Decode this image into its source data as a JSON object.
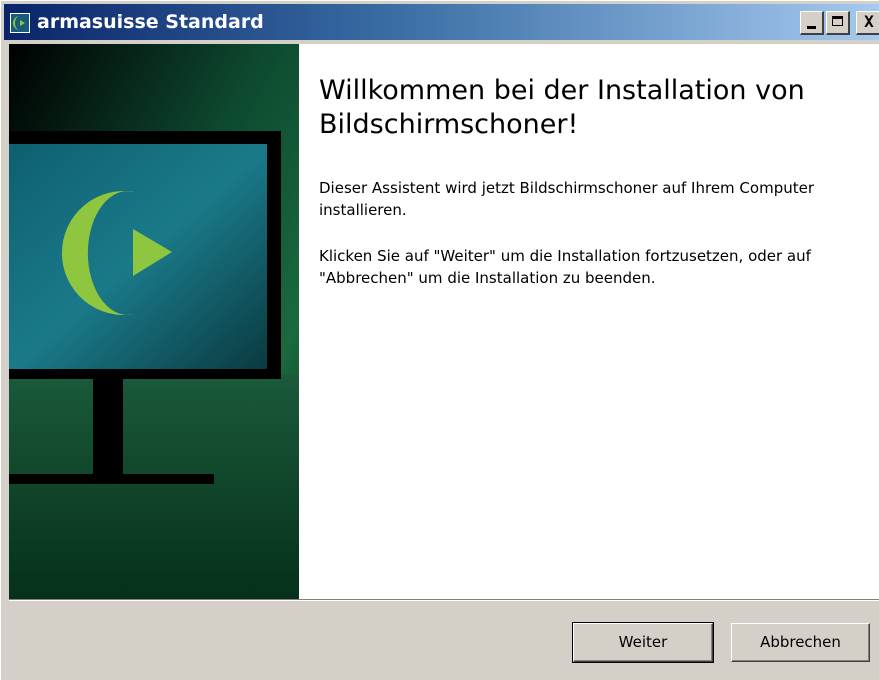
{
  "window": {
    "title": "armasuisse Standard",
    "controls": {
      "minimize_icon": "minimize-icon",
      "maximize_icon": "maximize-icon",
      "close_icon": "close-icon",
      "close_glyph": "X"
    }
  },
  "banner": {
    "logo_icon": "armasuisse-logo-icon",
    "colors": {
      "logo_green": "#8ec63f",
      "screen_teal": "#1a7a8a",
      "frame": "#000000",
      "background_green": "#1a6a3e"
    }
  },
  "content": {
    "heading": "Willkommen bei der Installation von Bildschirmschoner!",
    "paragraph_1": "Dieser Assistent wird jetzt Bildschirmschoner auf Ihrem Computer installieren.",
    "paragraph_2": "Klicken Sie auf \"Weiter\" um die Installation fortzusetzen, oder auf \"Abbrechen\" um die Installation zu beenden."
  },
  "buttons": {
    "next_label": "Weiter",
    "cancel_label": "Abbrechen"
  }
}
